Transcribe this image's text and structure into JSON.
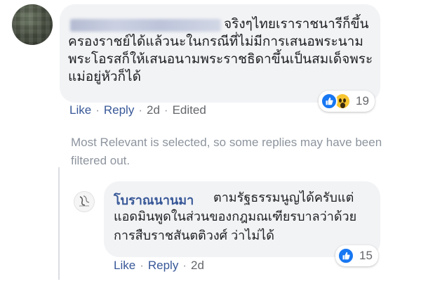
{
  "comment": {
    "text": "จริงๆไทยเราราชนารีก็ขึ้นครองราชย์ได้แล้วนะในกรณีที่ไม่มีการเสนอพระนามพระโอรสก็ให้เสนอนามพระราชธิดาขึ้นเป็นสมเด็จพระแม่อยู่หัวก็ได้",
    "reaction_count": "19",
    "reactions": [
      "like-icon",
      "wow-icon"
    ],
    "actions": {
      "like": "Like",
      "reply": "Reply",
      "time": "2d",
      "edited": "Edited"
    }
  },
  "filter_note": "Most Relevant is selected, so some replies may have been filtered out.",
  "reply": {
    "author": "โบราณนานมา",
    "text": "ตามรัฐธรรมนูญได้ครับแต่แอดมินพูดในส่วนของกฎมณเฑียรบาลว่าด้วยการสืบราชสันตติวงศ์ ว่าไม่ได้",
    "reaction_count": "15",
    "reactions": [
      "like-icon"
    ],
    "actions": {
      "like": "Like",
      "reply": "Reply",
      "time": "2d"
    }
  },
  "separator": "·",
  "colors": {
    "link": "#385898",
    "bubble": "#f2f3f5",
    "meta": "#65676b",
    "like": "#1877f2"
  }
}
